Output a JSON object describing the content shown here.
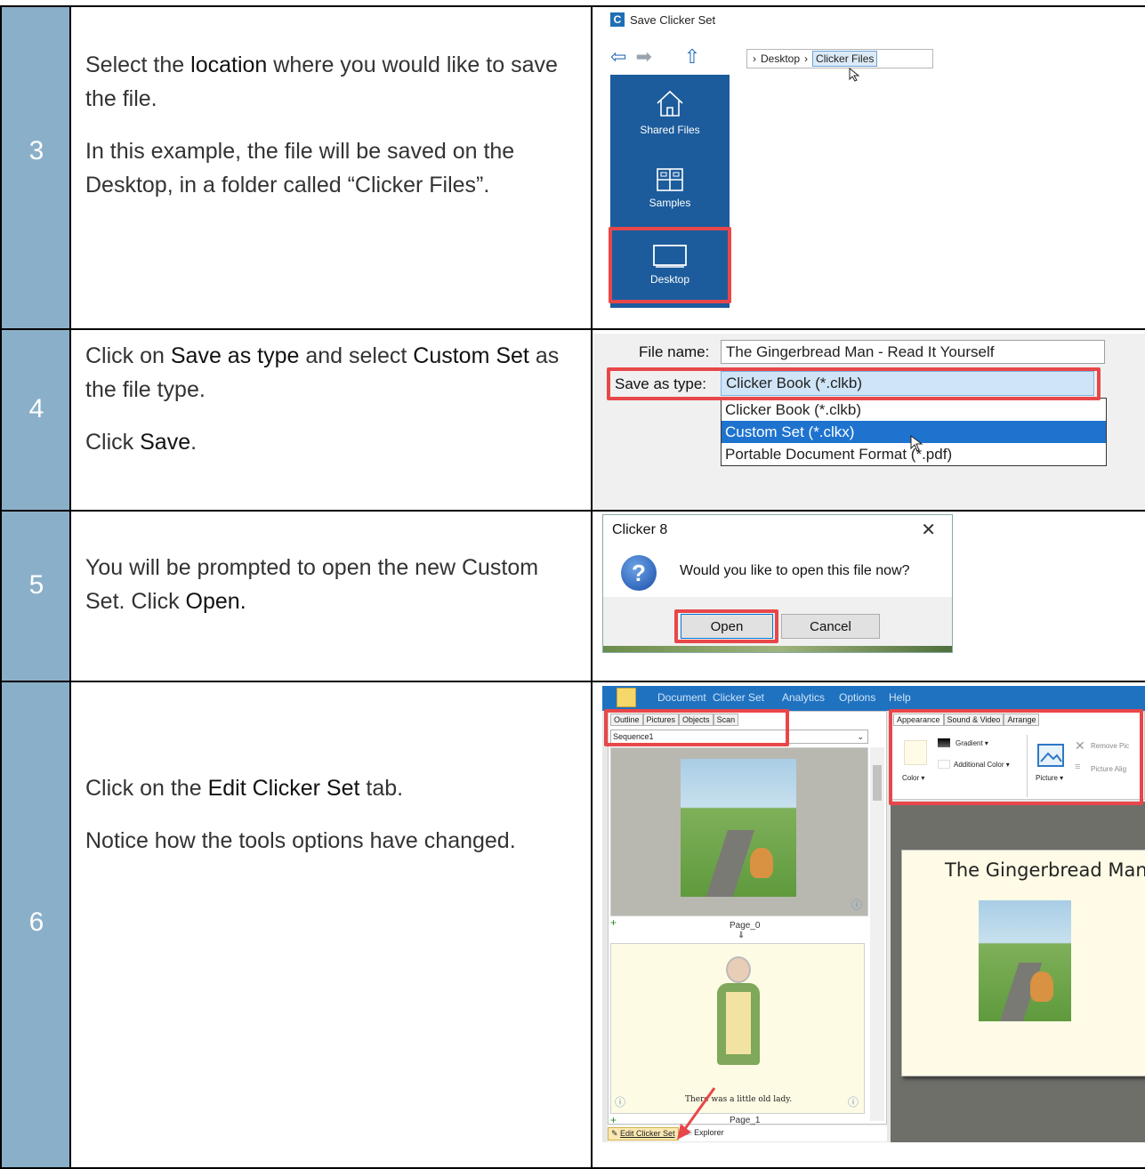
{
  "steps": [
    {
      "number": "3",
      "text": [
        [
          "Select the ",
          "location",
          " where you would like to save the file."
        ],
        [
          "In this example, the file will be saved on the Desktop, in a folder called “Clicker Files”."
        ]
      ]
    },
    {
      "number": "4",
      "text": [
        [
          "Click on ",
          "Save as type",
          " and select ",
          "Custom Set",
          " as the file type."
        ],
        [
          "Click ",
          "Save",
          "."
        ]
      ]
    },
    {
      "number": "5",
      "text": [
        [
          "You will be prompted to open the new Custom Set. Click ",
          "Open.",
          ""
        ]
      ]
    },
    {
      "number": "6",
      "text": [
        [
          "Click on the ",
          "Edit Clicker Set",
          " tab."
        ],
        [
          "Notice how the tools options have changed."
        ]
      ]
    }
  ],
  "save_dialog": {
    "logo": "C",
    "title": "Save Clicker Set",
    "breadcrumb": [
      "Desktop",
      "Clicker Files"
    ],
    "sidebar": [
      "Shared Files",
      "Samples",
      "Desktop"
    ]
  },
  "file_type": {
    "file_name_label": "File name:",
    "file_name_value": "The Gingerbread Man - Read It Yourself",
    "save_as_label": "Save as type:",
    "selected": "Clicker Book (*.clkb)",
    "options": [
      "Clicker Book (*.clkb)",
      "Custom Set (*.clkx)",
      "Portable Document Format (*.pdf)"
    ],
    "highlighted_index": 1
  },
  "prompt": {
    "title": "Clicker 8",
    "close_glyph": "✕",
    "message": "Would you like to open this file now?",
    "open_label": "Open",
    "cancel_label": "Cancel"
  },
  "editor": {
    "menus": [
      "Document",
      "Clicker Set",
      "Analytics",
      "Options",
      "Help"
    ],
    "left_tabs": [
      "Outline",
      "Pictures",
      "Objects",
      "Scan"
    ],
    "sequence": "Sequence1",
    "right_tabs": [
      "Appearance",
      "Sound & Video",
      "Arrange"
    ],
    "tools": {
      "gradient": "Gradient ▾",
      "color": "Color ▾",
      "additional_color": "Additional Color ▾",
      "picture": "Picture ▾",
      "remove_picture": "Remove Pic",
      "picture_align": "Picture Alig"
    },
    "pages": [
      "Page_0",
      "Page_1"
    ],
    "caption": "There was a little old lady.",
    "preview_title": "The Gingerbread Man",
    "bottom_tabs": [
      "Edit Clicker Set",
      "Explorer"
    ]
  },
  "colors": {
    "number_column": "#8aafc9",
    "highlight": "#e8474a",
    "accent_blue": "#1f72c0"
  }
}
